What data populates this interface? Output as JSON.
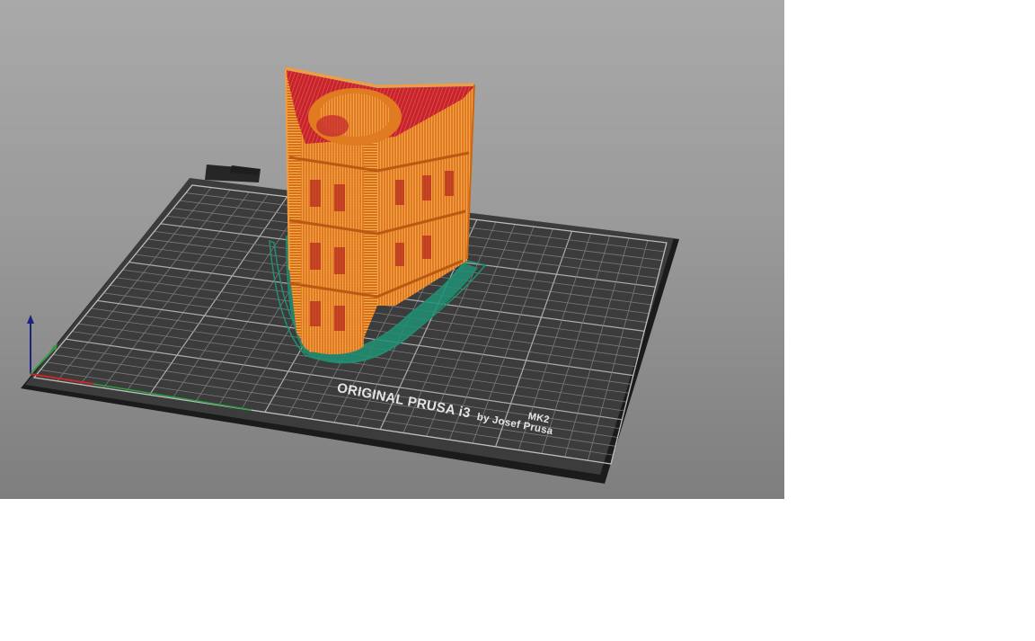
{
  "viewport": {
    "background_top": "#a9a9a9",
    "background_bottom": "#7e7e7e"
  },
  "bed": {
    "brand_line": "ORIGINAL PRUSA i3",
    "model_line": "MK2",
    "author_line": "by Josef Prusa",
    "surface_color": "#3c3c3c",
    "grid_color": "#8a8a8a"
  },
  "model": {
    "wall_color": "#e07b22",
    "top_infill_color": "#c4232f",
    "skirt_color": "#1f8f73"
  },
  "axes": {
    "x_color": "#c62828",
    "y_color": "#2e9e3e",
    "z_color": "#1a237e"
  }
}
